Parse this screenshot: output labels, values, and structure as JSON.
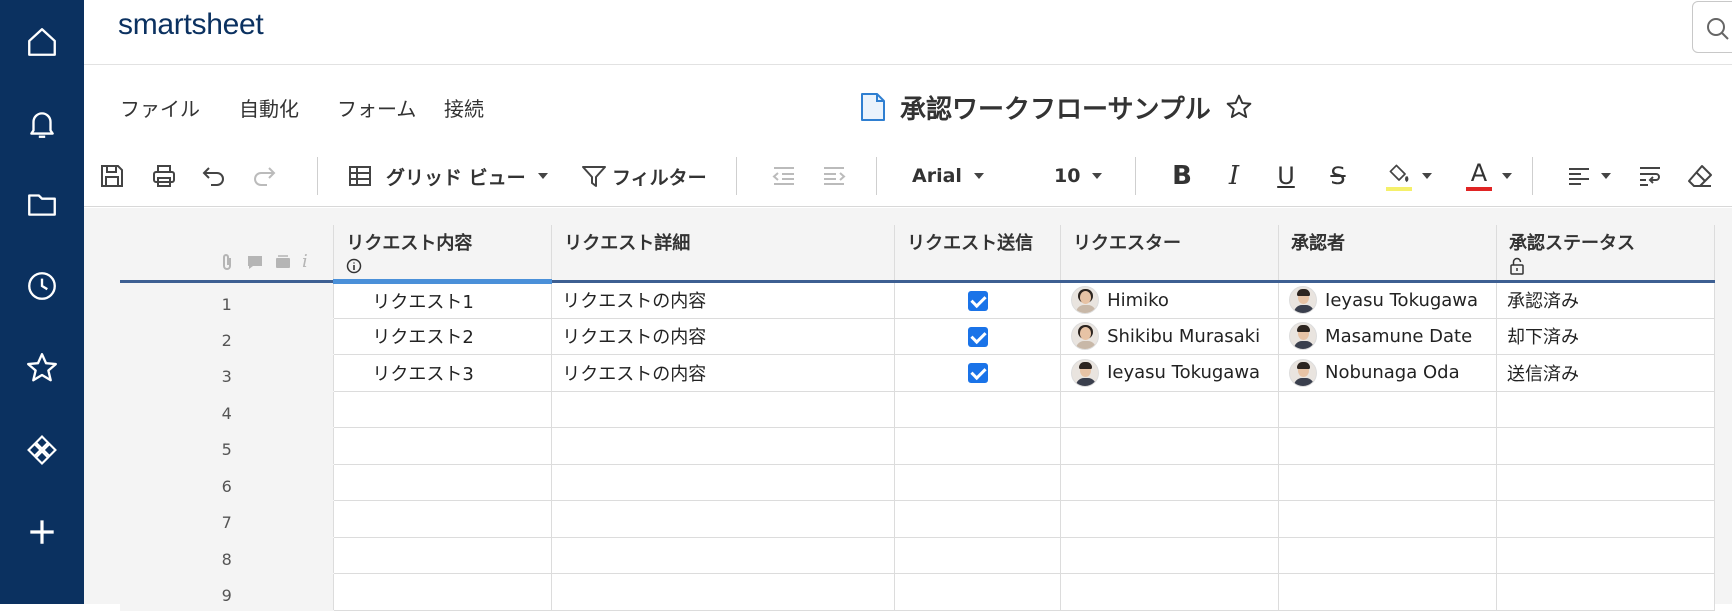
{
  "app": {
    "logo": "smartsheet"
  },
  "menu": {
    "items": [
      "ファイル",
      "自動化",
      "フォーム",
      "接続"
    ]
  },
  "sheet": {
    "title": "承認ワークフローサンプル"
  },
  "toolbar": {
    "view_label": "グリッド ビュー",
    "filter_label": "フィルター",
    "font": "Arial",
    "size": "10",
    "fill_underline_color": "#f5f06a",
    "text_underline_color": "#e02424"
  },
  "columns": [
    "リクエスト内容",
    "リクエスト詳細",
    "リクエスト送信",
    "リクエスター",
    "承認者",
    "承認ステータス"
  ],
  "rows": [
    {
      "num": "1",
      "content": "リクエスト1",
      "detail": "リクエストの内容",
      "sent": true,
      "requester": "Himiko",
      "approver": "Ieyasu Tokugawa",
      "status": "承認済み"
    },
    {
      "num": "2",
      "content": "リクエスト2",
      "detail": "リクエストの内容",
      "sent": true,
      "requester": "Shikibu Murasaki",
      "approver": "Masamune Date",
      "status": "却下済み"
    },
    {
      "num": "3",
      "content": "リクエスト3",
      "detail": "リクエストの内容",
      "sent": true,
      "requester": "Ieyasu Tokugawa",
      "approver": "Nobunaga Oda",
      "status": "送信済み"
    },
    {
      "num": "4"
    },
    {
      "num": "5"
    },
    {
      "num": "6"
    },
    {
      "num": "7"
    },
    {
      "num": "8"
    },
    {
      "num": "9"
    }
  ],
  "colors": {
    "rail": "#0b3160",
    "header_border": "#3d5f92",
    "active_col": "#4a90d9",
    "checkbox": "#1a73e8"
  }
}
